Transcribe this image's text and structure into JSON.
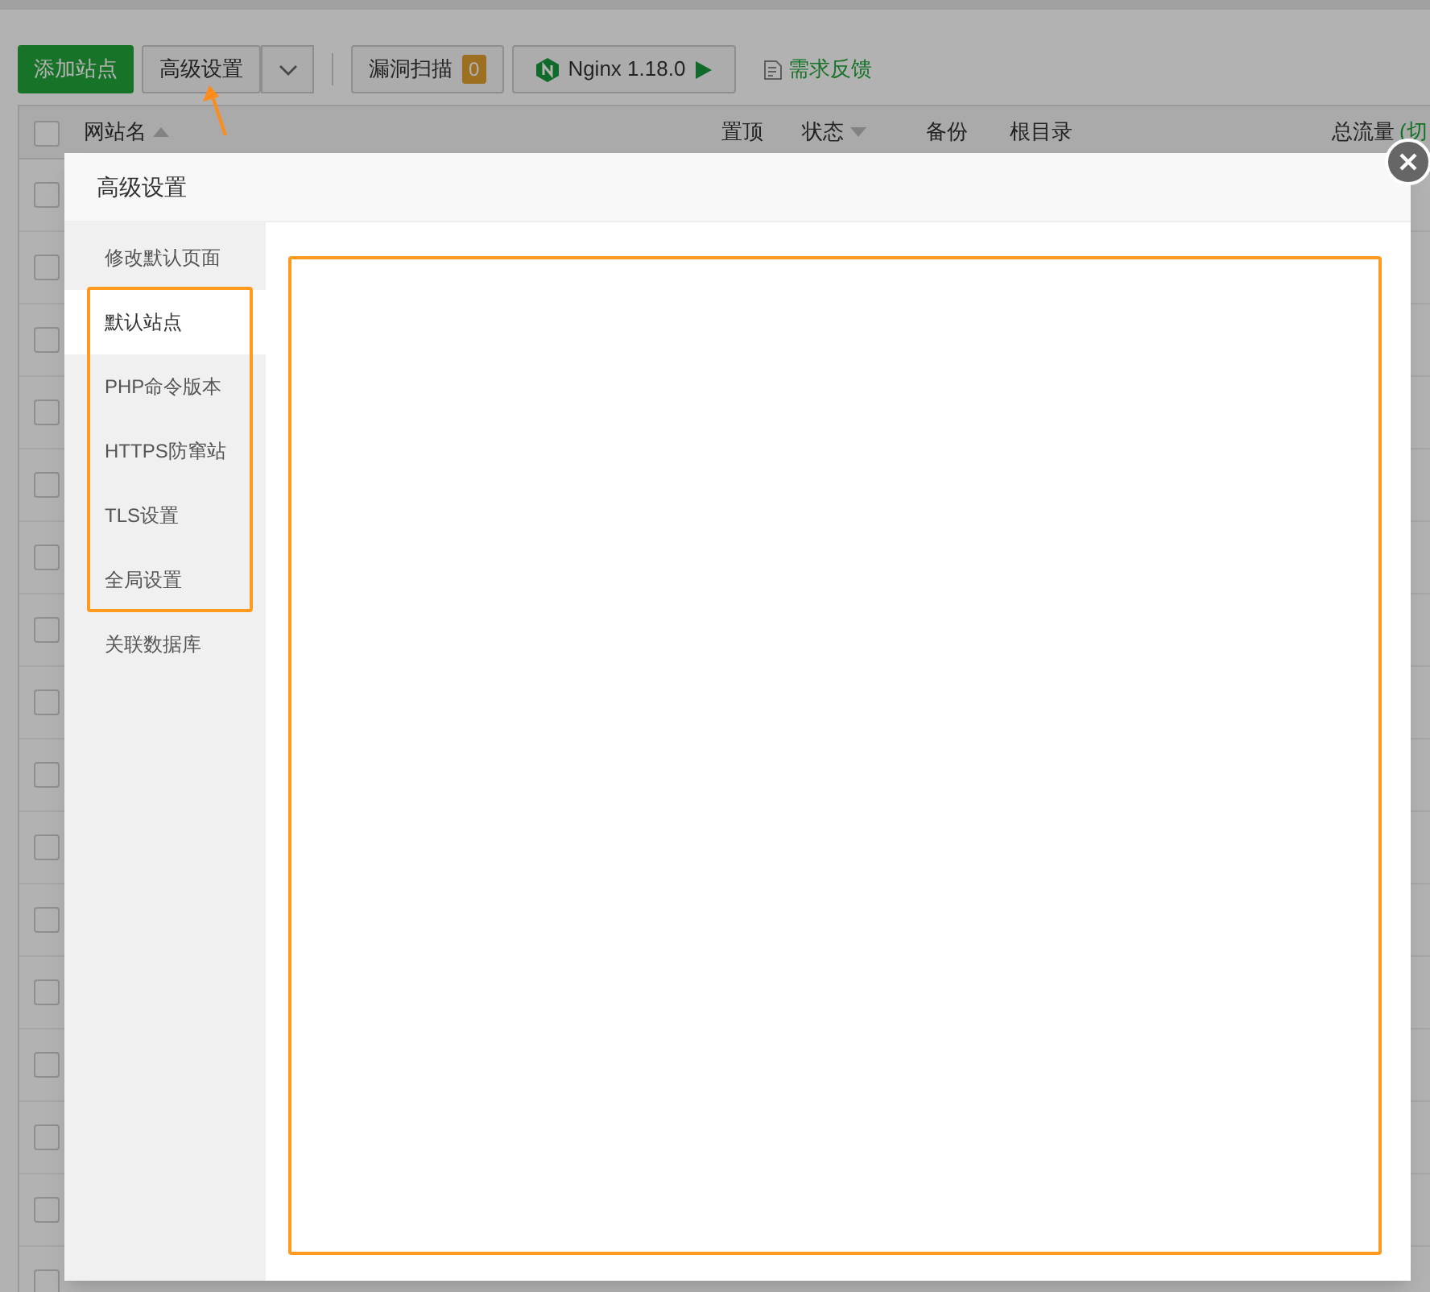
{
  "toolbar": {
    "add_button": "添加站点",
    "advanced_button": "高级设置",
    "scan_button": "漏洞扫描",
    "scan_count": "0",
    "nginx_button": "Nginx 1.18.0",
    "feedback_link": "需求反馈"
  },
  "table": {
    "select_all_checked": false,
    "columns": [
      {
        "label": "网站名",
        "sorted_ascending": true,
        "sorted_descending": false
      },
      {
        "label": "置顶",
        "sorted_ascending": false,
        "sorted_descending": false
      },
      {
        "label": "状态",
        "sorted_ascending": false,
        "sorted_descending": true
      },
      {
        "label": "备份",
        "sorted_ascending": false,
        "sorted_descending": false
      },
      {
        "label": "根目录",
        "sorted_ascending": false,
        "sorted_descending": false
      },
      {
        "label": "总流量",
        "sorted_ascending": false,
        "sorted_descending": false
      }
    ],
    "traffic_toggle": "(切",
    "rows": [
      {
        "checked": false
      },
      {
        "checked": false
      },
      {
        "checked": false
      },
      {
        "checked": false
      },
      {
        "checked": false
      },
      {
        "checked": false
      },
      {
        "checked": false
      },
      {
        "checked": false
      },
      {
        "checked": false
      },
      {
        "checked": false
      },
      {
        "checked": false
      },
      {
        "checked": false
      },
      {
        "checked": false
      },
      {
        "checked": false
      },
      {
        "checked": false
      },
      {
        "checked": false
      }
    ]
  },
  "dialog": {
    "title": "高级设置",
    "menu": [
      {
        "label": "修改默认页面",
        "selected": false
      },
      {
        "label": "默认站点",
        "selected": true
      },
      {
        "label": "PHP命令版本",
        "selected": false
      },
      {
        "label": "HTTPS防窜站",
        "selected": false
      },
      {
        "label": "TLS设置",
        "selected": false
      },
      {
        "label": "全局设置",
        "selected": false
      },
      {
        "label": "关联数据库",
        "selected": false
      }
    ]
  }
}
